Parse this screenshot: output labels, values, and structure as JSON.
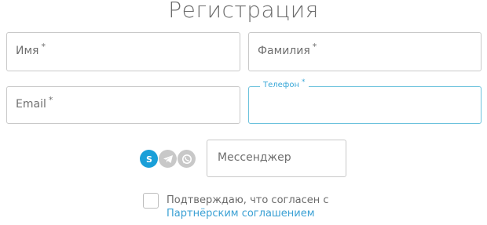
{
  "form": {
    "title": "Регистрация",
    "fields": {
      "first_name": {
        "label": "Имя",
        "required_mark": "*"
      },
      "last_name": {
        "label": "Фамилия",
        "required_mark": "*"
      },
      "email": {
        "label": "Email",
        "required_mark": "*"
      },
      "phone": {
        "label": "Телефон",
        "required_mark": "*",
        "value": ""
      },
      "messenger": {
        "placeholder": "Мессенджер"
      }
    },
    "messengers": [
      {
        "name": "skype-icon",
        "color": "#1a9fd8",
        "selected": true
      },
      {
        "name": "telegram-icon",
        "color": "#c8c8c8",
        "selected": false
      },
      {
        "name": "whatsapp-icon",
        "color": "#c8c8c8",
        "selected": false
      }
    ],
    "agreement": {
      "checked": false,
      "text": "Подтверждаю, что согласен с",
      "link_text": "Партнёрским соглашением"
    }
  }
}
